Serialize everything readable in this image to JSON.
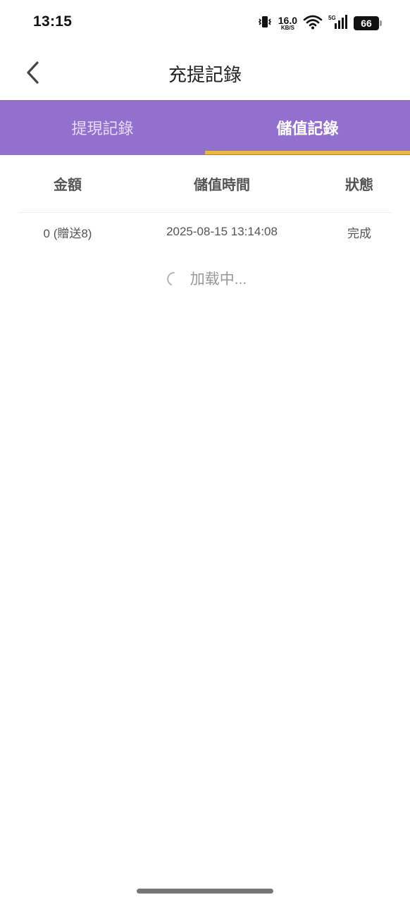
{
  "status_bar": {
    "time": "13:15",
    "net_speed_value": "16.0",
    "net_speed_unit": "KB/S",
    "signal_label": "5G",
    "battery": "66"
  },
  "header": {
    "title": "充提記錄"
  },
  "tabs": [
    {
      "label": "提現記錄",
      "active": false
    },
    {
      "label": "儲值記錄",
      "active": true
    }
  ],
  "table": {
    "columns": [
      "金額",
      "儲值時間",
      "狀態"
    ],
    "rows": [
      {
        "amount": "0 (贈送8)",
        "time": "2025-08-15 13:14:08",
        "status": "完成"
      }
    ]
  },
  "loading": {
    "text": "加载中..."
  },
  "colors": {
    "tab_bar": "#9170ce",
    "tab_indicator": "#f0b63e"
  }
}
